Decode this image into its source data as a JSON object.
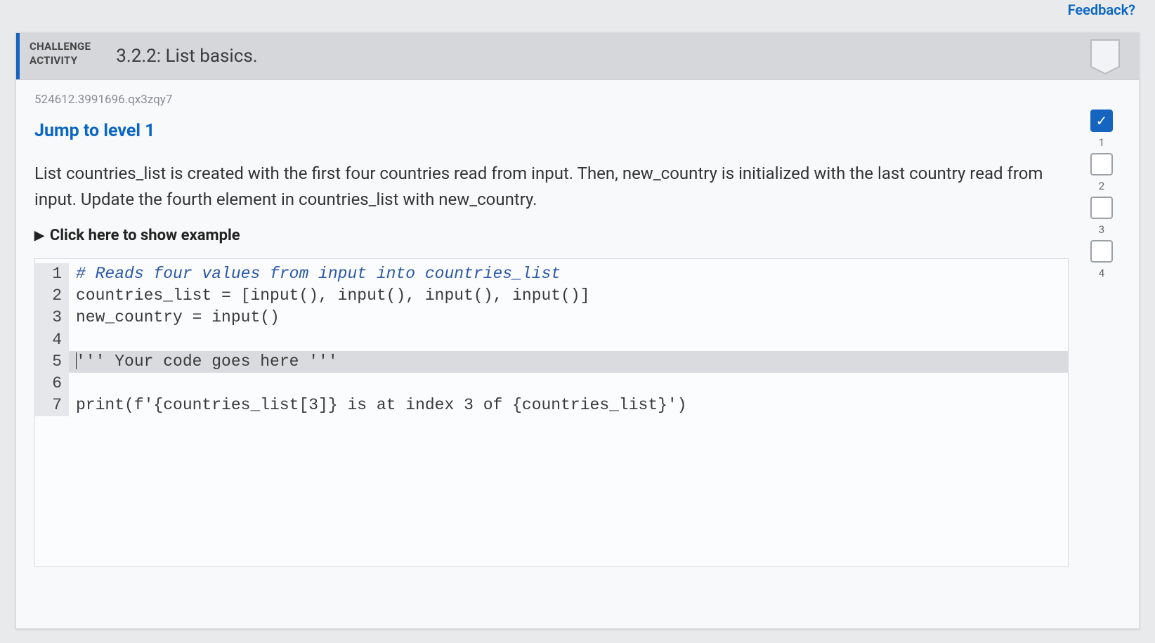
{
  "feedback_link": "Feedback?",
  "header": {
    "tag_line1": "CHALLENGE",
    "tag_line2": "ACTIVITY",
    "title": "3.2.2: List basics."
  },
  "session_id": "524612.3991696.qx3zqy7",
  "jump_label": "Jump to level 1",
  "problem_text": "List countries_list is created with the first four countries read from input. Then, new_country is initialized with the last country read from input. Update the fourth element in countries_list with new_country.",
  "example_toggle": "Click here to show example",
  "code": {
    "lines": [
      {
        "n": "1",
        "comment": true,
        "text": "# Reads four values from input into countries_list"
      },
      {
        "n": "2",
        "comment": false,
        "text": "countries_list = [input(), input(), input(), input()]"
      },
      {
        "n": "3",
        "comment": false,
        "text": "new_country = input()"
      },
      {
        "n": "4",
        "comment": false,
        "text": ""
      },
      {
        "n": "5",
        "comment": false,
        "text": "''' Your code goes here '''",
        "highlight": true,
        "caret": true
      },
      {
        "n": "6",
        "comment": false,
        "text": ""
      },
      {
        "n": "7",
        "comment": false,
        "text": "print(f'{countries_list[3]} is at index 3 of {countries_list}')"
      }
    ]
  },
  "levels": [
    {
      "label": "1",
      "done": true,
      "check": "✓"
    },
    {
      "label": "2",
      "done": false
    },
    {
      "label": "3",
      "done": false
    },
    {
      "label": "4",
      "done": false
    }
  ]
}
